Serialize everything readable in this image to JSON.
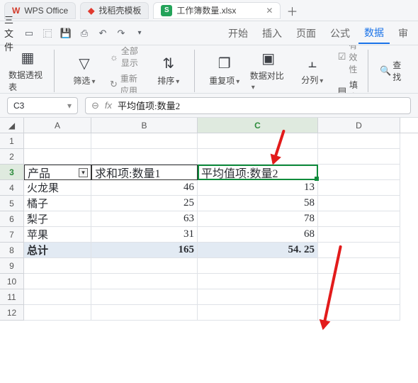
{
  "app_tabs": {
    "wps": {
      "label": "WPS Office"
    },
    "find": {
      "label": "找稻壳模板"
    },
    "sheet": {
      "label": "工作簿数量.xlsx",
      "icon_letter": "S"
    },
    "add_glyph": "＋"
  },
  "qat": {
    "menu_label": "三 文件",
    "icons": [
      "new",
      "open",
      "save",
      "print",
      "undo",
      "redo"
    ]
  },
  "menutabs": {
    "start": "开始",
    "insert": "插入",
    "page": "页面",
    "formula": "公式",
    "data": "数据",
    "review": "审"
  },
  "ribbon": {
    "pivot": {
      "label": "数据透视表"
    },
    "filter": {
      "label": "筛选"
    },
    "show_all": {
      "label": "全部显示"
    },
    "reapply": {
      "label": "重新应用"
    },
    "sort": {
      "label": "排序"
    },
    "dup": {
      "label": "重复项"
    },
    "compare": {
      "label": "数据对比"
    },
    "split": {
      "label": "分列"
    },
    "validate": {
      "label": "有效性"
    },
    "fill": {
      "label": "填充"
    },
    "findrep": {
      "label": "查找"
    }
  },
  "fx": {
    "name_box": "C3",
    "formula": "平均值项:数量2"
  },
  "columns": [
    "A",
    "B",
    "C",
    "D"
  ],
  "selected_col": "C",
  "selected_row": "3",
  "rows_visible": 12,
  "pivot": {
    "row_label": "产品",
    "col_b_label": "求和项:数量1",
    "col_c_label": "平均值项:数量2"
  },
  "data_rows": [
    {
      "a": "火龙果",
      "b": "46",
      "c": "13"
    },
    {
      "a": "橘子",
      "b": "25",
      "c": "58"
    },
    {
      "a": "梨子",
      "b": "63",
      "c": "78"
    },
    {
      "a": "苹果",
      "b": "31",
      "c": "68"
    }
  ],
  "total_row": {
    "a": "总计",
    "b": "165",
    "c": "54. 25"
  },
  "chart_data": {
    "type": "table",
    "title": "数据透视表",
    "columns": [
      "产品",
      "求和项:数量1",
      "平均值项:数量2"
    ],
    "rows": [
      [
        "火龙果",
        46,
        13
      ],
      [
        "橘子",
        25,
        58
      ],
      [
        "梨子",
        63,
        78
      ],
      [
        "苹果",
        31,
        68
      ]
    ],
    "totals": [
      "总计",
      165,
      54.25
    ]
  }
}
